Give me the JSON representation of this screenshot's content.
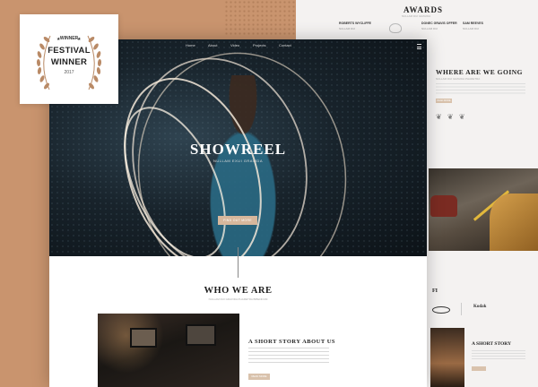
{
  "badge": {
    "winner_small": "WINNER",
    "line1": "FESTIVAL",
    "line2": "WINNER",
    "year": "2017",
    "accent": "#b98a66"
  },
  "nav": {
    "items": [
      "Home",
      "About",
      "Video",
      "Projects",
      "Contact"
    ]
  },
  "hero": {
    "title": "SHOWREEL",
    "subtitle": "NULLAM EXUI GRAVIDA",
    "button": "FIND OUT MORE"
  },
  "who": {
    "title": "WHO WE ARE",
    "subtitle": "NULLAM DUI GRAVIDA PHARETRA BIBENDUM"
  },
  "story": {
    "title": "A SHORT STORY ABOUT US",
    "button": "READ MORE"
  },
  "back": {
    "awards_title": "AWARDS",
    "awards_sub": "NULLAM DUI GRAVIDA",
    "award_items": [
      {
        "name": "ROBERTS WYCLIFFE",
        "meta": "NULLAM DUI"
      },
      {
        "name": "DONEC GRAVIS OFFER",
        "meta": "NULLAM DUI"
      },
      {
        "name": "SAM REEVES",
        "meta": "NULLAM DUI"
      }
    ],
    "going_title": "WHERE ARE WE GOING",
    "going_sub": "NULLAM DUI GRAVIDA PHARETRA",
    "going_button": "READ MORE",
    "story2_title": "A SHORT STORY",
    "logo_fi": "FI",
    "logo_b": "Kodak"
  },
  "colors": {
    "background": "#c9946e",
    "accent_button": "#d7b79c",
    "hero_dark": "#18232b"
  }
}
